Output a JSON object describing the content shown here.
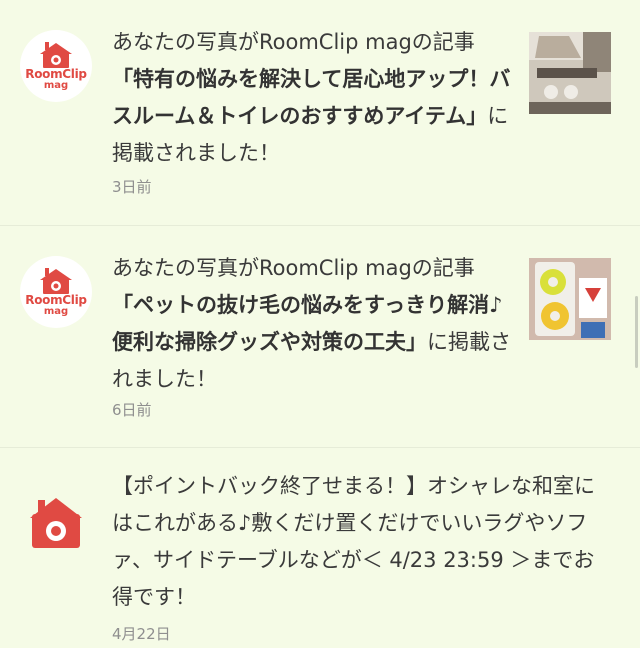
{
  "notifications": [
    {
      "avatar": {
        "brand": "RoomClip",
        "sub": "mag"
      },
      "prefix": "あなたの写真がRoomClip magの記事",
      "title": "「特有の悩みを解決して居心地アップ！バスルーム＆トイレのおすすめアイテム」",
      "suffix": "に掲載されました！",
      "time": "3日前"
    },
    {
      "avatar": {
        "brand": "RoomClip",
        "sub": "mag"
      },
      "prefix": "あなたの写真がRoomClip magの記事",
      "title": "「ペットの抜け毛の悩みをすっきり解消♪便利な掃除グッズや対策の工夫」",
      "suffix": "に掲載されました！",
      "time": "6日前"
    },
    {
      "body": "【ポイントバック終了せまる！】オシャレな和室にはこれがある♪敷くだけ置くだけでいいラグやソファ、サイドテーブルなどが＜ 4/23 23:59 ＞までお得です！",
      "time": "4月22日"
    }
  ],
  "colors": {
    "background": "#f5fbe6",
    "brand_red": "#e04a43",
    "text": "#3a3a3a",
    "time": "#8f8f8f"
  }
}
